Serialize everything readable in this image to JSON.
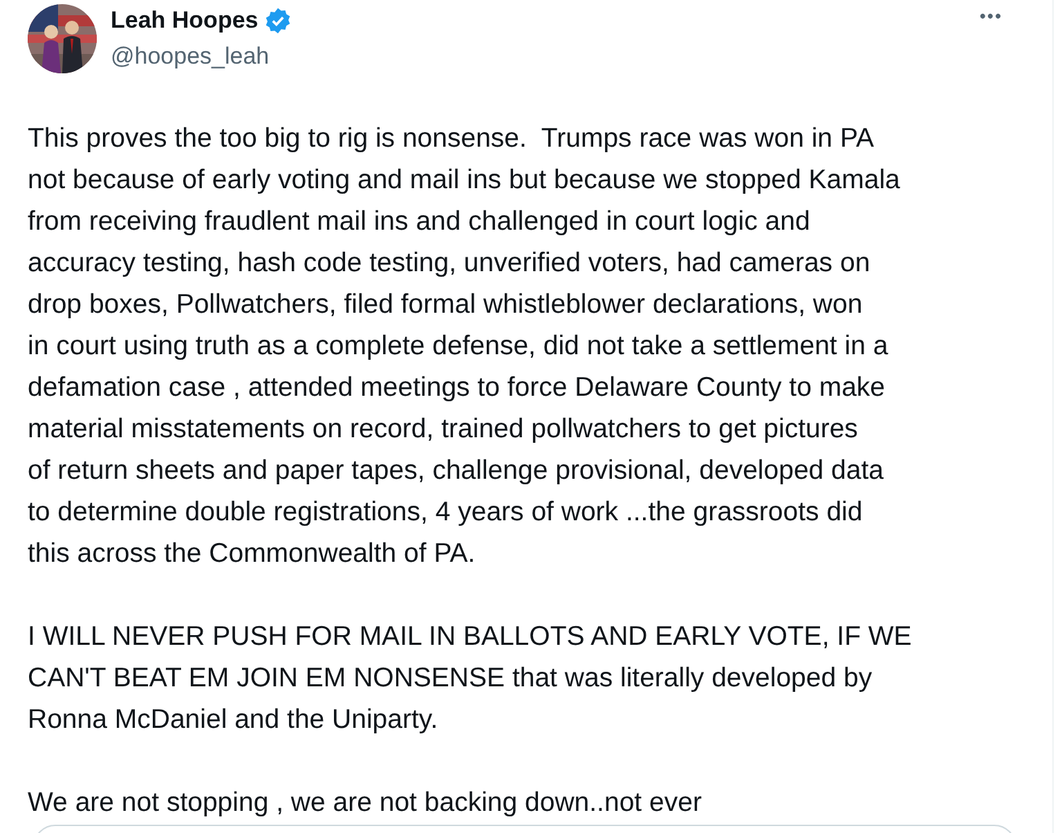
{
  "author": {
    "name": "Leah Hoopes",
    "verified": true,
    "handle": "@hoopes_leah"
  },
  "menu": "•••",
  "paragraphs": [
    [
      "This proves the too big to rig is nonsense.  Trumps race was won in PA",
      "not because of early voting and mail ins but because we stopped Kamala",
      "from receiving fraudlent mail ins and challenged in court logic and",
      "accuracy testing, hash code testing, unverified voters, had cameras on",
      "drop boxes, Pollwatchers, filed formal whistleblower declarations, won",
      "in court using truth as a complete defense, did not take a settlement in a",
      "defamation case , attended meetings to force Delaware County to make",
      "material misstatements on record, trained pollwatchers to get pictures",
      "of return sheets and paper tapes, challenge provisional, developed data",
      "to determine double registrations, 4 years of work ...the grassroots did",
      "this across the Commonwealth of PA."
    ],
    [
      "I WILL NEVER PUSH FOR MAIL IN BALLOTS AND EARLY VOTE, IF WE",
      "CAN'T BEAT EM JOIN EM NONSENSE that was literally developed by",
      "Ronna McDaniel and the Uniparty."
    ],
    [
      "We are not stopping , we are not backing down..not ever"
    ]
  ]
}
